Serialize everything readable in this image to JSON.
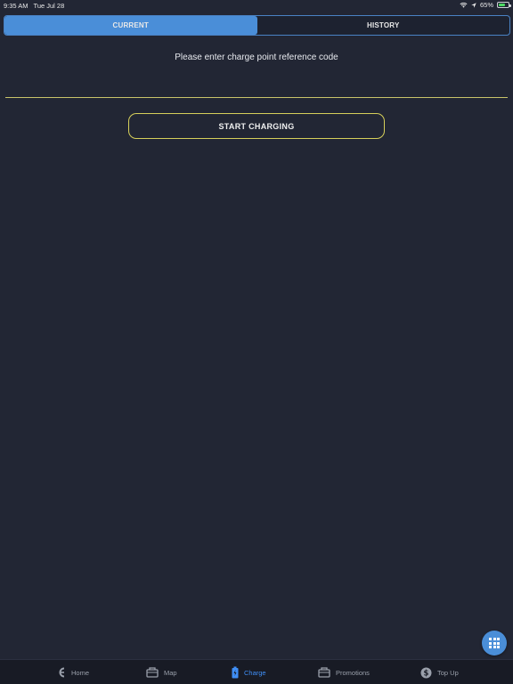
{
  "status_bar": {
    "time": "9:35 AM",
    "date": "Tue Jul 28",
    "battery_percent": "65%",
    "battery_level": 0.65,
    "battery_color": "#4cd964"
  },
  "segmented_control": {
    "tabs": [
      {
        "label": "CURRENT",
        "active": true
      },
      {
        "label": "HISTORY",
        "active": false
      }
    ],
    "active_color": "#4a8ed8"
  },
  "charge": {
    "prompt": "Please enter charge point reference code",
    "input_value": "",
    "input_placeholder": "",
    "button_label": "START CHARGING",
    "accent_color": "#d6cf5a"
  },
  "fab": {
    "icon": "grid-icon",
    "color": "#4a8ed8"
  },
  "tab_bar": {
    "items": [
      {
        "label": "Home",
        "icon": "home-logo-icon",
        "active": false
      },
      {
        "label": "Map",
        "icon": "map-icon",
        "active": false
      },
      {
        "label": "Charge",
        "icon": "battery-charge-icon",
        "active": true
      },
      {
        "label": "Promotions",
        "icon": "promotions-icon",
        "active": false
      },
      {
        "label": "Top Up",
        "icon": "dollar-icon",
        "active": false
      }
    ],
    "active_color": "#3f8ef5",
    "inactive_color": "#9aa0ab"
  }
}
